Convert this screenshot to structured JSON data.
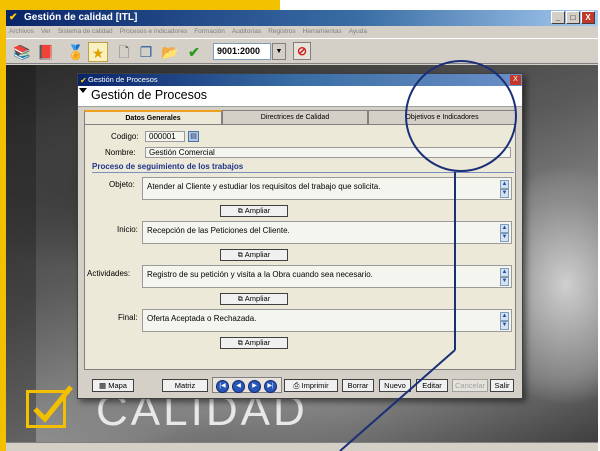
{
  "app": {
    "title": "Gestión de calidad [ITL]",
    "menu": [
      "Archivos",
      "Ver",
      "Sistema de calidad",
      "Procesos e indicadores",
      "Formación",
      "Auditorías",
      "Registros",
      "Herramientas",
      "Ayuda"
    ],
    "window_controls": [
      "_",
      "□",
      "X"
    ],
    "toolbar": {
      "icons": [
        "books-icon",
        "books-red-icon",
        "certificate-icon",
        "star-icon",
        "document-icon",
        "copy-icon",
        "folder-icon",
        "checkmark-icon"
      ],
      "norm_select": "9001:2000",
      "stop_symbol": "⊘"
    }
  },
  "dialog": {
    "title": "Gestión de Procesos",
    "heading": "Gestión de Procesos",
    "close_symbol": "X",
    "tabs": [
      {
        "label": "Datos Generales",
        "active": true
      },
      {
        "label": "Directrices de Calidad",
        "active": false
      },
      {
        "label": "Objetivos e Indicadores",
        "active": false
      }
    ],
    "codigo": {
      "label": "Codigo:",
      "value": "000001"
    },
    "nombre": {
      "label": "Nombre:",
      "value": "Gestión Comercial"
    },
    "section_title": "Proceso de seguimiento de los trabajos",
    "fields": [
      {
        "label": "Objeto:",
        "value": "Atender al Cliente y estudiar los requisitos del trabajo que solicita."
      },
      {
        "label": "Inicio:",
        "value": "Recepción de las Peticiones del Cliente."
      },
      {
        "label": "Actividades:",
        "value": "Registro de su petición y visita a la Obra cuando sea necesario."
      },
      {
        "label": "Final:",
        "value": "Oferta Aceptada o Rechazada."
      }
    ],
    "ampliar_label": "Ampliar",
    "buttons": {
      "mapa": "Mapa",
      "matriz": "Matriz",
      "imprimir": "Imprimir",
      "borrar": "Borrar",
      "nuevo": "Nuevo",
      "editar": "Editar",
      "cancelar": "Cancelar",
      "salir": "Salir"
    },
    "nav_symbols": [
      "|◀",
      "◀",
      "▶",
      "▶|"
    ]
  },
  "brand": {
    "text": "CALIDAD",
    "color": "#f3c000"
  },
  "colors": {
    "titlebar": "#0a246a",
    "accent_yellow": "#f3c000",
    "callout": "#1a2f78",
    "section_title": "#20358a"
  }
}
